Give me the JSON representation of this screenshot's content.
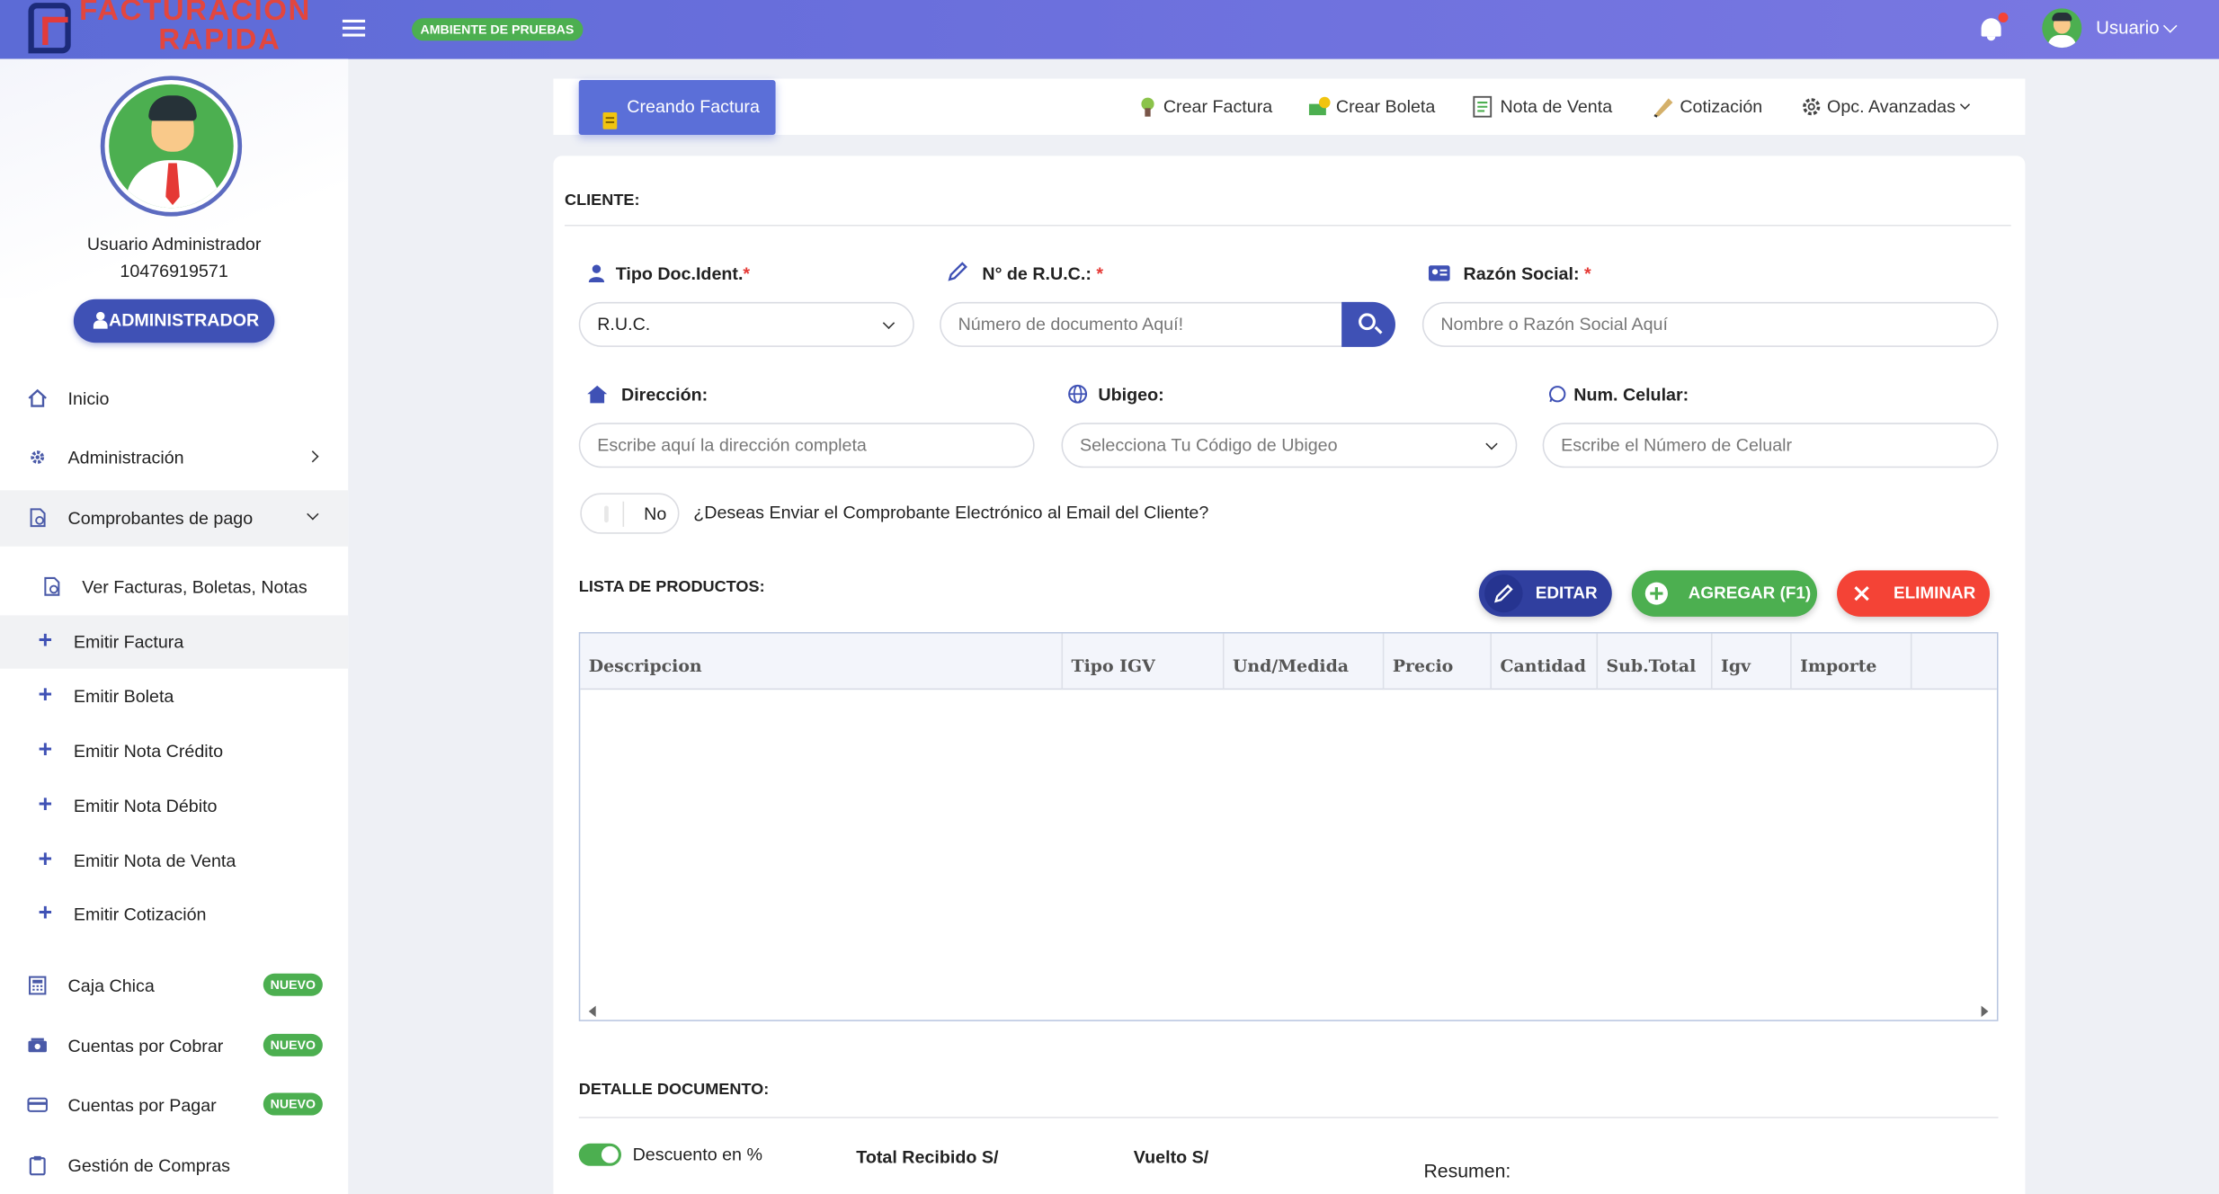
{
  "header": {
    "logo_line1": "FACTURACION",
    "logo_line2": "RAPIDA",
    "env_badge": "AMBIENTE DE PRUEBAS",
    "user_label": "Usuario"
  },
  "sidebar": {
    "user_name": "Usuario Administrador",
    "user_id": "10476919571",
    "role_button": "ADMINISTRADOR",
    "items": [
      {
        "label": "Inicio",
        "icon": "home-icon"
      },
      {
        "label": "Administración",
        "icon": "gear-icon"
      },
      {
        "label": "Comprobantes de pago",
        "icon": "document-icon"
      }
    ],
    "sub_items": [
      {
        "label": "Ver Facturas, Boletas, Notas"
      },
      {
        "label": "Emitir Factura"
      },
      {
        "label": "Emitir Boleta"
      },
      {
        "label": "Emitir Nota Crédito"
      },
      {
        "label": "Emitir Nota Débito"
      },
      {
        "label": "Emitir Nota de Venta"
      },
      {
        "label": "Emitir Cotización"
      }
    ],
    "extra_items": [
      {
        "label": "Caja Chica",
        "badge": "NUEVO",
        "icon": "calculator-icon"
      },
      {
        "label": "Cuentas por Cobrar",
        "badge": "NUEVO",
        "icon": "money-icon"
      },
      {
        "label": "Cuentas por Pagar",
        "badge": "NUEVO",
        "icon": "card-icon"
      },
      {
        "label": "Gestión de Compras",
        "icon": "clipboard-icon"
      }
    ]
  },
  "toolbar": {
    "creating": "Creando Factura",
    "links": [
      "Crear Factura",
      "Crear Boleta",
      "Nota de Venta",
      "Cotización",
      "Opc. Avanzadas"
    ]
  },
  "cliente": {
    "title": "CLIENTE:",
    "tipo_doc_label": "Tipo Doc.Ident.",
    "tipo_doc_value": "R.U.C.",
    "ruc_label": "N° de R.U.C.:",
    "ruc_placeholder": "Número de documento Aquí!",
    "razon_label": "Razón Social:",
    "razon_placeholder": "Nombre o Razón Social Aquí",
    "direccion_label": "Dirección:",
    "direccion_placeholder": "Escribe aquí la dirección completa",
    "ubigeo_label": "Ubigeo:",
    "ubigeo_placeholder": "Selecciona Tu Código de Ubigeo",
    "celular_label": "Num. Celular:",
    "celular_placeholder": "Escribe el Número de Celualr",
    "email_toggle": "No",
    "email_question": "¿Deseas Enviar el Comprobante Electrónico al Email del Cliente?",
    "required_mark": "*"
  },
  "productos": {
    "title": "LISTA DE PRODUCTOS:",
    "btn_edit": "EDITAR",
    "btn_add": "AGREGAR (F1)",
    "btn_delete": "ELIMINAR",
    "columns": [
      "Descripcion",
      "Tipo IGV",
      "Und/Medida",
      "Precio",
      "Cantidad",
      "Sub.Total",
      "Igv",
      "Importe"
    ]
  },
  "detalle": {
    "title": "DETALLE DOCUMENTO:",
    "descuento": "Descuento en %",
    "total_recibido": "Total Recibido S/",
    "vuelto": "Vuelto S/",
    "resumen": "Resumen:"
  },
  "colors": {
    "primary": "#3f51b5",
    "success": "#4caf50",
    "danger": "#f44336"
  }
}
